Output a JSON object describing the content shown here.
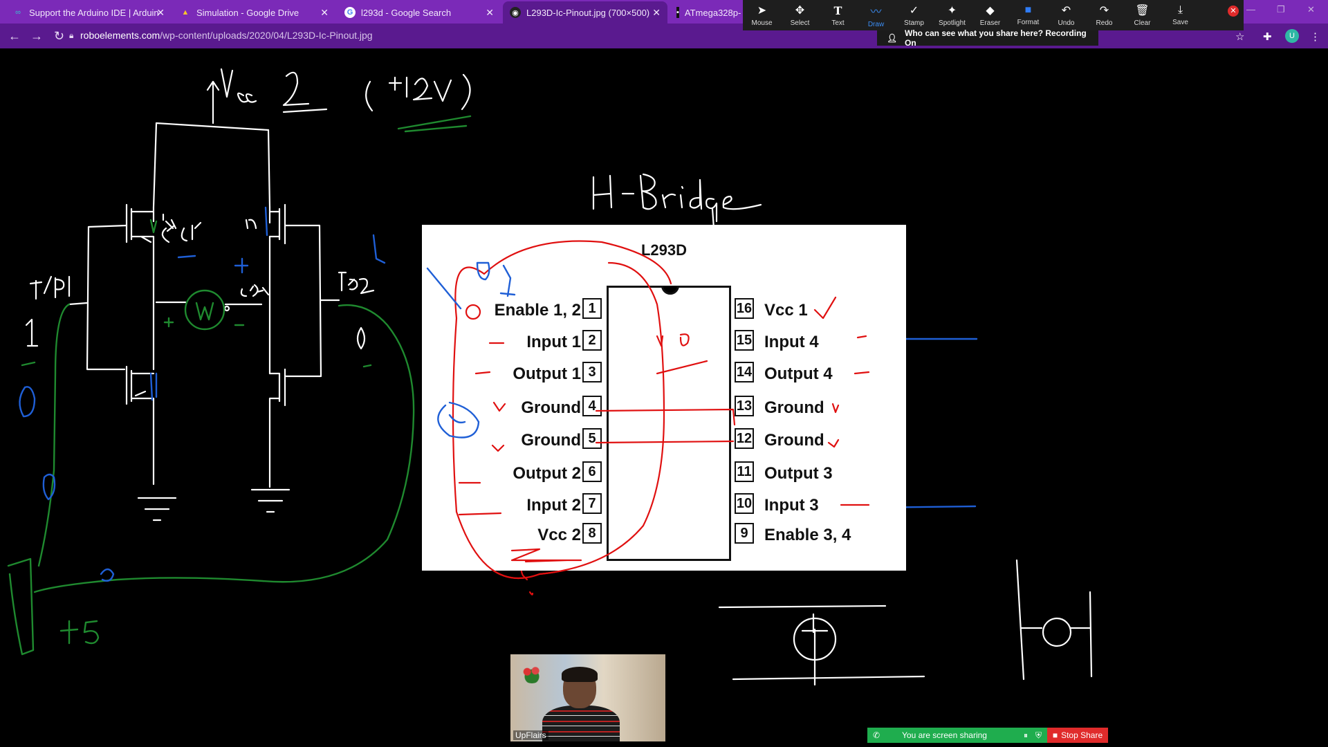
{
  "tabs": [
    {
      "title": "Support the Arduino IDE | Arduin",
      "icon": "arduino-icon"
    },
    {
      "title": "Simulation - Google Drive",
      "icon": "google-drive-icon"
    },
    {
      "title": "l293d - Google Search",
      "icon": "google-icon"
    },
    {
      "title": "L293D-Ic-Pinout.jpg (700×500)",
      "icon": "image-icon"
    },
    {
      "title": "ATmega328p-",
      "icon": "page-icon"
    }
  ],
  "address": {
    "domain": "roboelements.com",
    "path": "/wp-content/uploads/2020/04/L293D-Ic-Pinout.jpg"
  },
  "annotate_toolbar": [
    {
      "label": "Mouse",
      "icon": "cursor-icon"
    },
    {
      "label": "Select",
      "icon": "move-icon"
    },
    {
      "label": "Text",
      "icon": "text-icon"
    },
    {
      "label": "Draw",
      "icon": "draw-icon"
    },
    {
      "label": "Stamp",
      "icon": "check-icon"
    },
    {
      "label": "Spotlight",
      "icon": "spotlight-icon"
    },
    {
      "label": "Eraser",
      "icon": "eraser-icon"
    },
    {
      "label": "Format",
      "icon": "format-icon"
    },
    {
      "label": "Undo",
      "icon": "undo-icon"
    },
    {
      "label": "Redo",
      "icon": "redo-icon"
    },
    {
      "label": "Clear",
      "icon": "trash-icon"
    },
    {
      "label": "Save",
      "icon": "save-icon"
    }
  ],
  "share_notice": "Who can see what you share here? Recording On",
  "pinout": {
    "title": "L293D",
    "left_pins": [
      {
        "num": "1",
        "label": "Enable 1, 2"
      },
      {
        "num": "2",
        "label": "Input 1"
      },
      {
        "num": "3",
        "label": "Output 1"
      },
      {
        "num": "4",
        "label": "Ground"
      },
      {
        "num": "5",
        "label": "Ground"
      },
      {
        "num": "6",
        "label": "Output 2"
      },
      {
        "num": "7",
        "label": "Input 2"
      },
      {
        "num": "8",
        "label": "Vcc 2"
      }
    ],
    "right_pins": [
      {
        "num": "16",
        "label": "Vcc 1"
      },
      {
        "num": "15",
        "label": "Input 4"
      },
      {
        "num": "14",
        "label": "Output 4"
      },
      {
        "num": "13",
        "label": "Ground"
      },
      {
        "num": "12",
        "label": "Ground"
      },
      {
        "num": "11",
        "label": "Output 3"
      },
      {
        "num": "10",
        "label": "Input 3"
      },
      {
        "num": "9",
        "label": "Enable 3, 4"
      }
    ]
  },
  "video": {
    "participant": "UpFlairs"
  },
  "sharing_bar": {
    "status": "You are screen sharing",
    "stop_label": "Stop Share"
  }
}
